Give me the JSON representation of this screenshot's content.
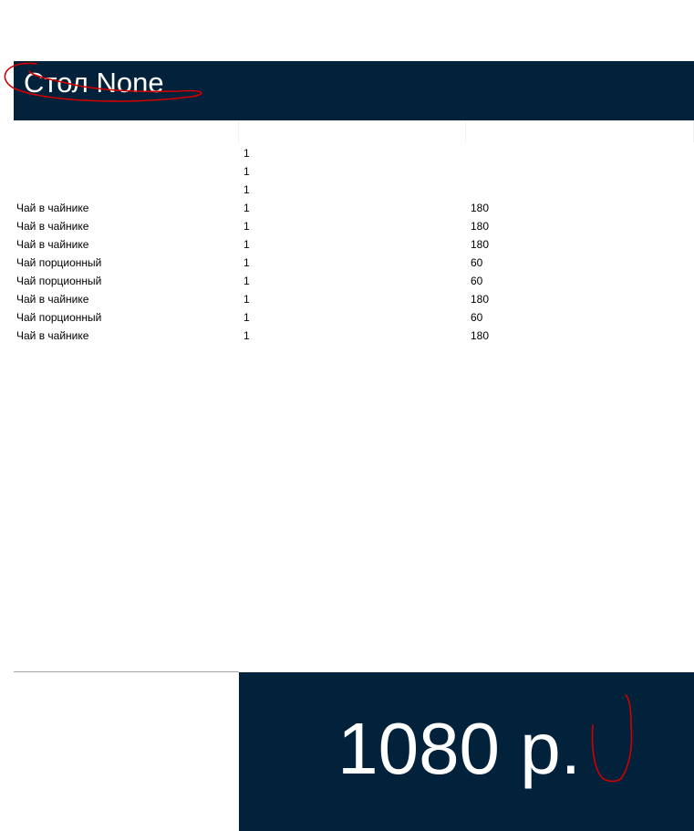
{
  "header": {
    "title": "Стол None"
  },
  "table": {
    "columns": [
      "",
      "",
      ""
    ],
    "rows": [
      {
        "name": "",
        "qty": "1",
        "price": ""
      },
      {
        "name": "",
        "qty": "1",
        "price": ""
      },
      {
        "name": "",
        "qty": "1",
        "price": ""
      },
      {
        "name": "Чай в чайнике",
        "qty": "1",
        "price": "180"
      },
      {
        "name": "Чай в чайнике",
        "qty": "1",
        "price": "180"
      },
      {
        "name": "Чай в чайнике",
        "qty": "1",
        "price": "180"
      },
      {
        "name": "Чай порционный",
        "qty": "1",
        "price": "60"
      },
      {
        "name": "Чай порционный",
        "qty": "1",
        "price": "60"
      },
      {
        "name": "Чай в чайнике",
        "qty": "1",
        "price": "180"
      },
      {
        "name": "Чай порционный",
        "qty": "1",
        "price": "60"
      },
      {
        "name": "Чай в чайнике",
        "qty": "1",
        "price": "180"
      }
    ]
  },
  "total": {
    "text": "1080 р."
  },
  "colors": {
    "dark_navy": "#02213a",
    "annotation_red": "#d40000",
    "text_white": "#ffffff"
  }
}
